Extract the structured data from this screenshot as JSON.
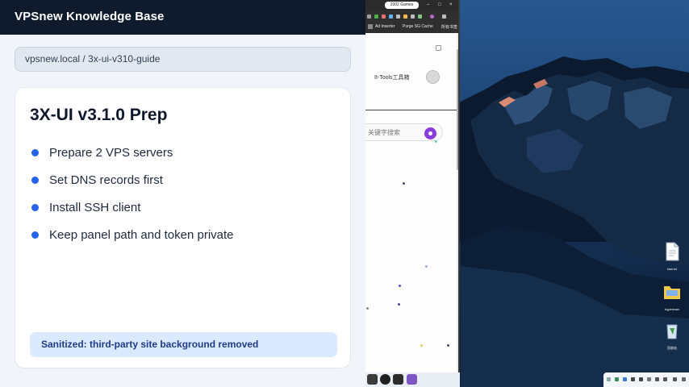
{
  "app": {
    "title": "VPSnew Knowledge Base"
  },
  "breadcrumb": {
    "text": "vpsnew.local / 3x-ui-v310-guide"
  },
  "card": {
    "title": "3X-UI v3.1.0 Prep",
    "steps": [
      "Prepare 2 VPS servers",
      "Set DNS records first",
      "Install SSH client",
      "Keep panel path and token private"
    ],
    "notice": "Sanitized: third-party site background removed"
  },
  "browser": {
    "tab_label": "2002 Games",
    "bookmarks": [
      "Ad Inserter",
      "Purge SG Cache"
    ],
    "bookmark_folder": "所有书签",
    "site_name": "It-Tools工具箱",
    "search_placeholder": "关键字搜索",
    "window_controls": [
      "–",
      "□",
      "×"
    ]
  },
  "desktop": {
    "icons": [
      {
        "label": "fast.txt",
        "icon": "document-icon"
      },
      {
        "label": "hyperman",
        "icon": "folder-icon"
      },
      {
        "label": "回收站",
        "icon": "recycle-bin-icon"
      }
    ]
  },
  "colors": {
    "header_bg": "#0f1b2d",
    "accent": "#2563eb",
    "notice_bg": "#dbeafe",
    "notice_text": "#1e3a8a",
    "search_button": "#8b3bd9"
  }
}
